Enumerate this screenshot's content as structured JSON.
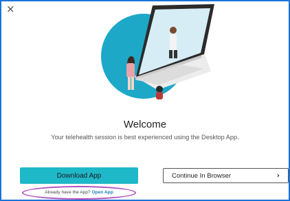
{
  "dialog": {
    "close_icon": "×",
    "title": "Welcome",
    "subtitle": "Your telehealth session is best experienced using the Desktop App."
  },
  "actions": {
    "download_label": "Download App",
    "browser_label": "Continue In Browser",
    "browser_chevron": "›",
    "already_text": "Already have the App?",
    "open_app_label": "Open App"
  },
  "colors": {
    "accent": "#1fb8c9",
    "link": "#1a7fb5",
    "highlight": "#b04fc0",
    "frame_border": "#1a73d9"
  },
  "icons": [
    "close-icon",
    "chevron-right-icon"
  ]
}
